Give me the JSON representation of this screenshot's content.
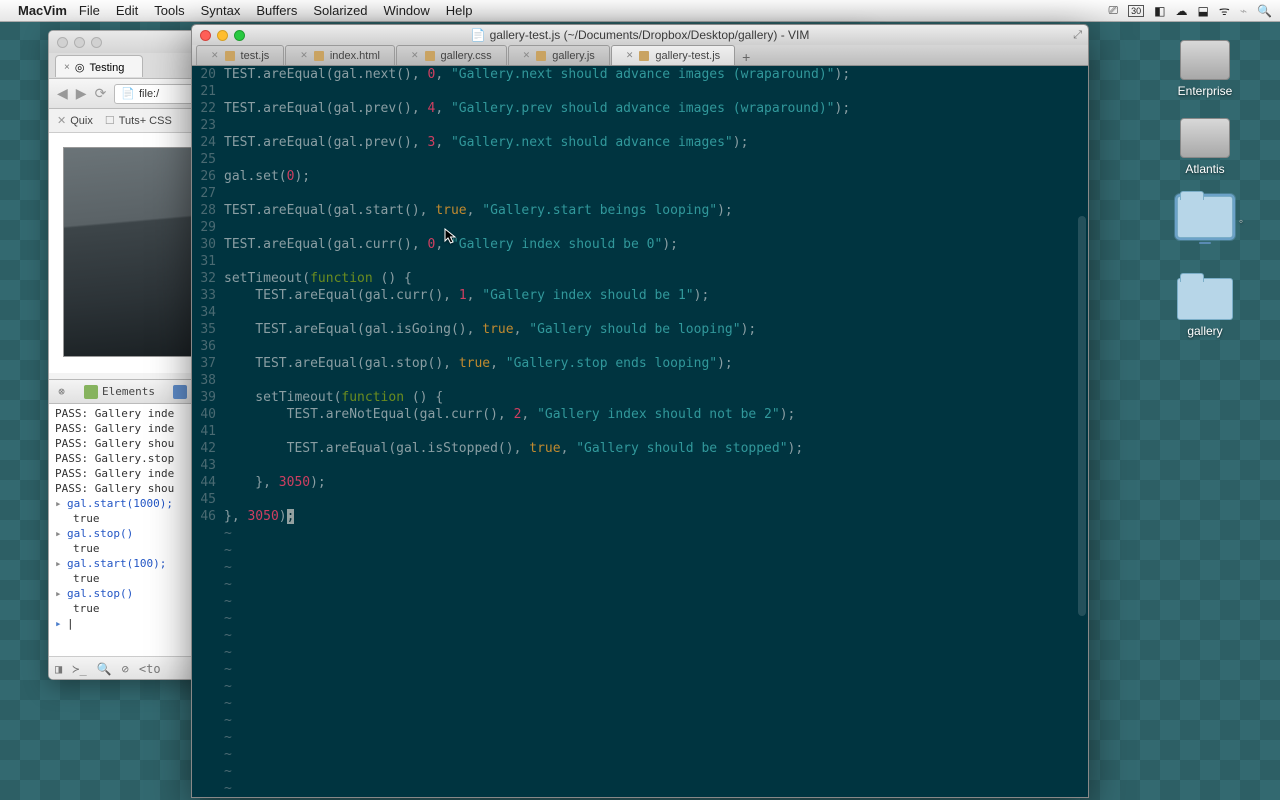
{
  "menubar": {
    "app": "MacVim",
    "items": [
      "File",
      "Edit",
      "Tools",
      "Syntax",
      "Buffers",
      "Solarized",
      "Window",
      "Help"
    ],
    "date": "30"
  },
  "desktop": {
    "drives": [
      "Enterprise",
      "Atlantis"
    ],
    "folders": [
      "",
      "gallery"
    ],
    "selected_index": 0
  },
  "browser": {
    "tab_title": "Testing",
    "url": "file:/",
    "bookmarks": [
      {
        "label": "Quix",
        "icon": "✕"
      },
      {
        "label": "Tuts+ CSS",
        "icon": "☐"
      }
    ]
  },
  "devtools": {
    "tabs": [
      "Elements"
    ],
    "console": [
      {
        "t": "pass",
        "text": "PASS: Gallery inde"
      },
      {
        "t": "pass",
        "text": "PASS: Gallery inde"
      },
      {
        "t": "pass",
        "text": "PASS: Gallery shou"
      },
      {
        "t": "pass",
        "text": "PASS: Gallery.stop"
      },
      {
        "t": "pass",
        "text": "PASS: Gallery inde"
      },
      {
        "t": "pass",
        "text": "PASS: Gallery shou"
      },
      {
        "t": "exp",
        "text": "gal.start(1000);"
      },
      {
        "t": "res",
        "text": "true"
      },
      {
        "t": "exp",
        "text": "gal.stop()"
      },
      {
        "t": "res",
        "text": "true"
      },
      {
        "t": "exp",
        "text": "gal.start(100);"
      },
      {
        "t": "res",
        "text": "true"
      },
      {
        "t": "exp",
        "text": "gal.stop()"
      },
      {
        "t": "res",
        "text": "true"
      },
      {
        "t": "prompt",
        "text": ""
      }
    ],
    "status_crumb": "<to"
  },
  "vim": {
    "title": "gallery-test.js (~/Documents/Dropbox/Desktop/gallery) - VIM",
    "tabs": [
      "test.js",
      "index.html",
      "gallery.css",
      "gallery.js",
      "gallery-test.js"
    ],
    "active_tab": 4,
    "first_line": 20,
    "code": [
      [
        [
          "TEST.areEqual(gal.next(), ",
          "p"
        ],
        [
          "0",
          "n"
        ],
        [
          ", ",
          "p"
        ],
        [
          "\"Gallery.next should advance images (wraparound)\"",
          "s"
        ],
        [
          ");",
          "p"
        ]
      ],
      [],
      [
        [
          "TEST.areEqual(gal.prev(), ",
          "p"
        ],
        [
          "4",
          "n"
        ],
        [
          ", ",
          "p"
        ],
        [
          "\"Gallery.prev should advance images (wraparound)\"",
          "s"
        ],
        [
          ");",
          "p"
        ]
      ],
      [],
      [
        [
          "TEST.areEqual(gal.prev(), ",
          "p"
        ],
        [
          "3",
          "n"
        ],
        [
          ", ",
          "p"
        ],
        [
          "\"Gallery.next should advance images\"",
          "s"
        ],
        [
          ");",
          "p"
        ]
      ],
      [],
      [
        [
          "gal.set(",
          "p"
        ],
        [
          "0",
          "n"
        ],
        [
          ");",
          "p"
        ]
      ],
      [],
      [
        [
          "TEST.areEqual(gal.start(), ",
          "p"
        ],
        [
          "true",
          "b"
        ],
        [
          ", ",
          "p"
        ],
        [
          "\"Gallery.start beings looping\"",
          "s"
        ],
        [
          ");",
          "p"
        ]
      ],
      [],
      [
        [
          "TEST.areEqual(gal.curr(), ",
          "p"
        ],
        [
          "0",
          "n"
        ],
        [
          ", ",
          "p"
        ],
        [
          "\"Gallery index should be 0\"",
          "s"
        ],
        [
          ");",
          "p"
        ]
      ],
      [],
      [
        [
          "setTimeout(",
          "p"
        ],
        [
          "function",
          "k"
        ],
        [
          " () {",
          "p"
        ]
      ],
      [
        [
          "    TEST.areEqual(gal.curr(), ",
          "p"
        ],
        [
          "1",
          "n"
        ],
        [
          ", ",
          "p"
        ],
        [
          "\"Gallery index should be 1\"",
          "s"
        ],
        [
          ");",
          "p"
        ]
      ],
      [],
      [
        [
          "    TEST.areEqual(gal.isGoing(), ",
          "p"
        ],
        [
          "true",
          "b"
        ],
        [
          ", ",
          "p"
        ],
        [
          "\"Gallery should be looping\"",
          "s"
        ],
        [
          ");",
          "p"
        ]
      ],
      [],
      [
        [
          "    TEST.areEqual(gal.stop(), ",
          "p"
        ],
        [
          "true",
          "b"
        ],
        [
          ", ",
          "p"
        ],
        [
          "\"Gallery.stop ends looping\"",
          "s"
        ],
        [
          ");",
          "p"
        ]
      ],
      [],
      [
        [
          "    setTimeout(",
          "p"
        ],
        [
          "function",
          "k"
        ],
        [
          " () {",
          "p"
        ]
      ],
      [
        [
          "        TEST.areNotEqual(gal.curr(), ",
          "p"
        ],
        [
          "2",
          "n"
        ],
        [
          ", ",
          "p"
        ],
        [
          "\"Gallery index should not be 2\"",
          "s"
        ],
        [
          ");",
          "p"
        ]
      ],
      [],
      [
        [
          "        TEST.areEqual(gal.isStopped(), ",
          "p"
        ],
        [
          "true",
          "b"
        ],
        [
          ", ",
          "p"
        ],
        [
          "\"Gallery should be stopped\"",
          "s"
        ],
        [
          ");",
          "p"
        ]
      ],
      [],
      [
        [
          "    }, ",
          "p"
        ],
        [
          "3050",
          "n"
        ],
        [
          ");",
          "p"
        ]
      ],
      [],
      [
        [
          "}, ",
          "p"
        ],
        [
          "3050",
          "n"
        ],
        [
          ")",
          "p"
        ],
        [
          ";",
          "cur"
        ]
      ]
    ]
  }
}
